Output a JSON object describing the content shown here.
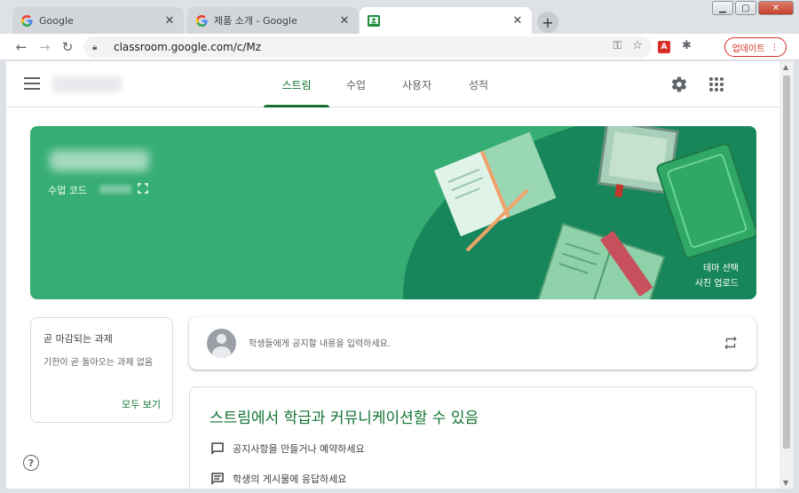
{
  "browser": {
    "tabs": [
      {
        "title": "Google",
        "favicon": "google-g-icon"
      },
      {
        "title": "제품 소개 - Google",
        "favicon": "google-g-icon"
      },
      {
        "title": "",
        "favicon": "classroom-icon"
      }
    ],
    "url": "classroom.google.com/c/Mz",
    "update_label": "업데이트",
    "colors": {
      "accent": "#137333",
      "banner": "#36ad73",
      "update": "#d93025"
    }
  },
  "app": {
    "nav_tabs": [
      "스트림",
      "수업",
      "사용자",
      "성적"
    ],
    "active_tab": "스트림"
  },
  "banner": {
    "code_label": "수업 코드",
    "theme_label": "테마 선택",
    "photo_label": "사진 업로드"
  },
  "due": {
    "title": "곧 마감되는 과제",
    "body": "기한이 곧 돌아오는 과제 없음",
    "link": "모두 보기"
  },
  "announce": {
    "placeholder": "학생들에게 공지할 내용을 입력하세요."
  },
  "stream": {
    "title": "스트림에서 학급과 커뮤니케이션할 수 있음",
    "items": [
      "공지사항을 만들거나 예약하세요",
      "학생의 게시물에 응답하세요"
    ]
  }
}
